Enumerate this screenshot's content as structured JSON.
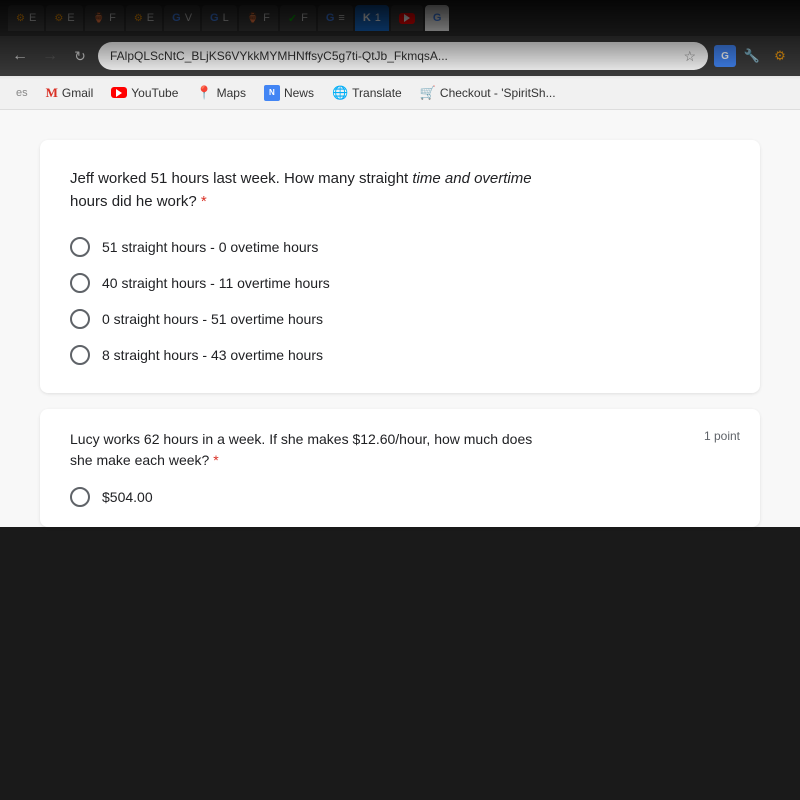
{
  "browser": {
    "url": "FAlpQLScNtC_BLjKS6VYkkMYMHNffsyC5g7ti-QtJb_FkmqsA...",
    "bookmarks": [
      {
        "id": "gmail",
        "label": "Gmail",
        "icon": "gmail"
      },
      {
        "id": "youtube",
        "label": "YouTube",
        "icon": "youtube"
      },
      {
        "id": "maps",
        "label": "Maps",
        "icon": "maps"
      },
      {
        "id": "news",
        "label": "News",
        "icon": "news"
      },
      {
        "id": "translate",
        "label": "Translate",
        "icon": "translate"
      },
      {
        "id": "checkout",
        "label": "Checkout - 'SpiritSh...",
        "icon": "checkout"
      }
    ]
  },
  "question1": {
    "text": "Jeff worked 51 hours last week. How many straight time and overtime hours did he work?",
    "required": true,
    "options": [
      {
        "id": "a",
        "label": "51 straight hours - 0 ovetime hours"
      },
      {
        "id": "b",
        "label": "40 straight hours - 11 overtime hours"
      },
      {
        "id": "c",
        "label": "0 straight hours - 51 overtime hours"
      },
      {
        "id": "d",
        "label": "8 straight hours - 43 overtime hours"
      }
    ]
  },
  "question2": {
    "text": "Lucy works 62 hours in a week. If she makes $12.60/hour, how much does she make each week?",
    "required": true,
    "points": "1 point",
    "options": [
      {
        "id": "a",
        "label": "$504.00"
      }
    ]
  }
}
